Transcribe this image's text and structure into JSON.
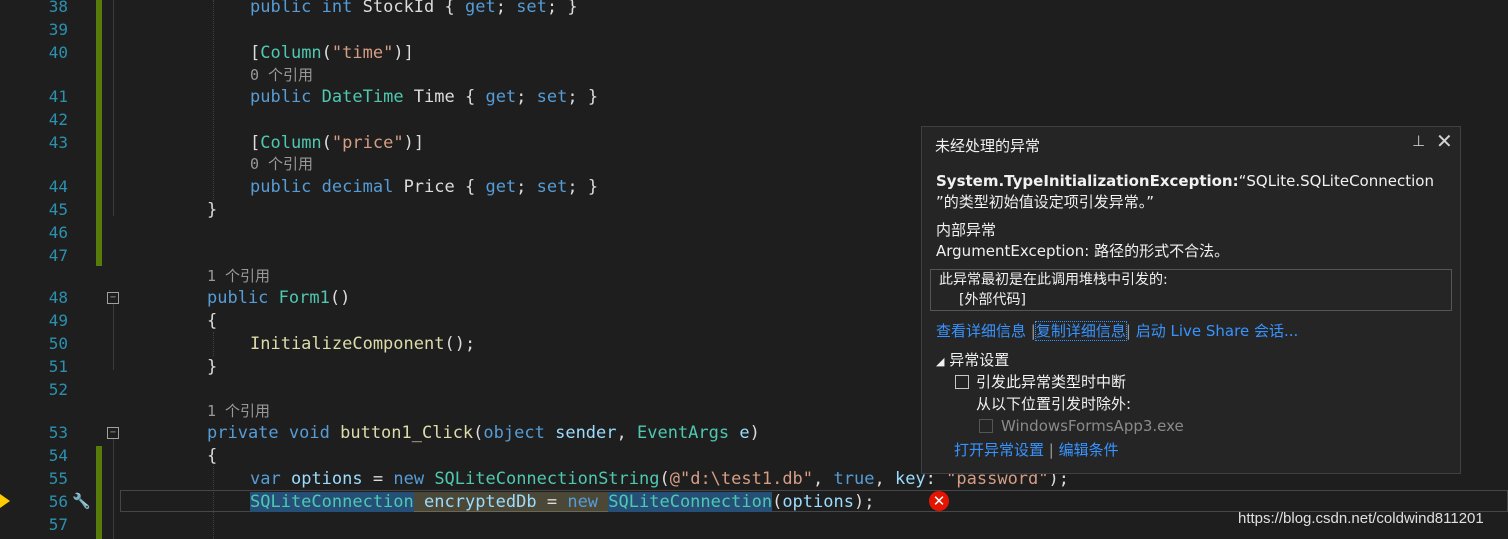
{
  "editor": {
    "lines": [
      {
        "num": "38",
        "tokens": [
          [
            "kw",
            "public"
          ],
          [
            "pl",
            " "
          ],
          [
            "kw",
            "int"
          ],
          [
            "pl",
            " StockId { "
          ],
          [
            "kw",
            "get"
          ],
          [
            "pl",
            "; "
          ],
          [
            "kw",
            "set"
          ],
          [
            "pl",
            "; }"
          ]
        ]
      },
      {
        "num": "39",
        "tokens": []
      },
      {
        "num": "40",
        "tokens": [
          [
            "pl",
            "["
          ],
          [
            "ty",
            "Column"
          ],
          [
            "pl",
            "("
          ],
          [
            "str",
            "\"time\""
          ],
          [
            "pl",
            ")]"
          ]
        ]
      },
      {
        "num": "41",
        "tokens": [
          [
            "kw",
            "public"
          ],
          [
            "pl",
            " "
          ],
          [
            "ty",
            "DateTime"
          ],
          [
            "pl",
            " Time { "
          ],
          [
            "kw",
            "get"
          ],
          [
            "pl",
            "; "
          ],
          [
            "kw",
            "set"
          ],
          [
            "pl",
            "; }"
          ]
        ]
      },
      {
        "num": "42",
        "tokens": []
      },
      {
        "num": "43",
        "tokens": [
          [
            "pl",
            "["
          ],
          [
            "ty",
            "Column"
          ],
          [
            "pl",
            "("
          ],
          [
            "str",
            "\"price\""
          ],
          [
            "pl",
            ")]"
          ]
        ]
      },
      {
        "num": "44",
        "tokens": [
          [
            "kw",
            "public"
          ],
          [
            "pl",
            " "
          ],
          [
            "kw",
            "decimal"
          ],
          [
            "pl",
            " Price { "
          ],
          [
            "kw",
            "get"
          ],
          [
            "pl",
            "; "
          ],
          [
            "kw",
            "set"
          ],
          [
            "pl",
            "; }"
          ]
        ]
      },
      {
        "num": "45",
        "tokens": [
          [
            "pl",
            "}"
          ]
        ]
      },
      {
        "num": "46",
        "tokens": []
      },
      {
        "num": "47",
        "tokens": []
      },
      {
        "num": "48",
        "tokens": [
          [
            "kw",
            "public"
          ],
          [
            "pl",
            " "
          ],
          [
            "ty",
            "Form1"
          ],
          [
            "pl",
            "()"
          ]
        ]
      },
      {
        "num": "49",
        "tokens": [
          [
            "pl",
            "{"
          ]
        ]
      },
      {
        "num": "50",
        "tokens": [
          [
            "fn",
            "InitializeComponent"
          ],
          [
            "pl",
            "();"
          ]
        ]
      },
      {
        "num": "51",
        "tokens": [
          [
            "pl",
            "}"
          ]
        ]
      },
      {
        "num": "52",
        "tokens": []
      },
      {
        "num": "53",
        "tokens": [
          [
            "kw",
            "private"
          ],
          [
            "pl",
            " "
          ],
          [
            "kw",
            "void"
          ],
          [
            "pl",
            " "
          ],
          [
            "fn",
            "button1_Click"
          ],
          [
            "pl",
            "("
          ],
          [
            "kw",
            "object"
          ],
          [
            "pl",
            " "
          ],
          [
            "par",
            "sender"
          ],
          [
            "pl",
            ", "
          ],
          [
            "ty",
            "EventArgs"
          ],
          [
            "pl",
            " "
          ],
          [
            "par",
            "e"
          ],
          [
            "pl",
            ")"
          ]
        ]
      },
      {
        "num": "54",
        "tokens": [
          [
            "pl",
            "{"
          ]
        ]
      },
      {
        "num": "55",
        "tokens": [
          [
            "kw",
            "var"
          ],
          [
            "pl",
            " "
          ],
          [
            "par",
            "options"
          ],
          [
            "pl",
            " = "
          ],
          [
            "kw",
            "new"
          ],
          [
            "pl",
            " "
          ],
          [
            "ty",
            "SQLiteConnectionString"
          ],
          [
            "pl",
            "("
          ],
          [
            "str",
            "@\"d:\\test1.db\""
          ],
          [
            "pl",
            ", "
          ],
          [
            "kw",
            "true"
          ],
          [
            "pl",
            ", "
          ],
          [
            "par",
            "key"
          ],
          [
            "pl",
            ": "
          ],
          [
            "str",
            "\"password\""
          ],
          [
            "pl",
            ");"
          ]
        ]
      },
      {
        "num": "56",
        "tokens": [
          [
            "ty",
            "SQLiteConnection"
          ],
          [
            "pl",
            " "
          ],
          [
            "par",
            "encryptedDb"
          ],
          [
            "pl",
            " = "
          ],
          [
            "kw",
            "new"
          ],
          [
            "pl",
            " "
          ],
          [
            "ty",
            "SQLiteConnection"
          ],
          [
            "pl",
            "("
          ],
          [
            "par",
            "options"
          ],
          [
            "pl",
            ");"
          ]
        ]
      },
      {
        "num": "57",
        "tokens": []
      }
    ],
    "codelens": {
      "ref0": "0 个引用",
      "ref1": "1 个引用"
    }
  },
  "exception_popup": {
    "title": "未经处理的异常",
    "message_type": "System.TypeInitializationException:",
    "message_rest": "“SQLite.SQLiteConnection",
    "message_line2": "”的类型初始值设定项引发异常。”",
    "inner_label": "内部异常",
    "inner_message": "ArgumentException: 路径的形式不合法。",
    "stack_line1": "此异常最初是在此调用堆栈中引发的:",
    "stack_line2": "[外部代码]",
    "link_details": "查看详细信息",
    "link_copy": "复制详细信息",
    "link_liveshare": "启动 Live Share 会话...",
    "settings_header": "异常设置",
    "break_label": "引发此异常类型时中断",
    "except_label": "从以下位置引发时除外:",
    "exe_label": "WindowsFormsApp3.exe",
    "link_open_settings": "打开异常设置",
    "link_edit_conditions": "编辑条件"
  },
  "watermark": "https://blog.csdn.net/coldwind811201",
  "icons": {
    "error": "error-x-icon",
    "pin": "pin-icon",
    "close": "close-icon",
    "current-line": "current-statement-arrow-icon"
  },
  "colors": {
    "background": "#1e1e1e",
    "keyword": "#569cd6",
    "type": "#4ec9b0",
    "string": "#d69d85",
    "line_number": "#2b91af",
    "link": "#3794ff",
    "error": "#e51400"
  }
}
